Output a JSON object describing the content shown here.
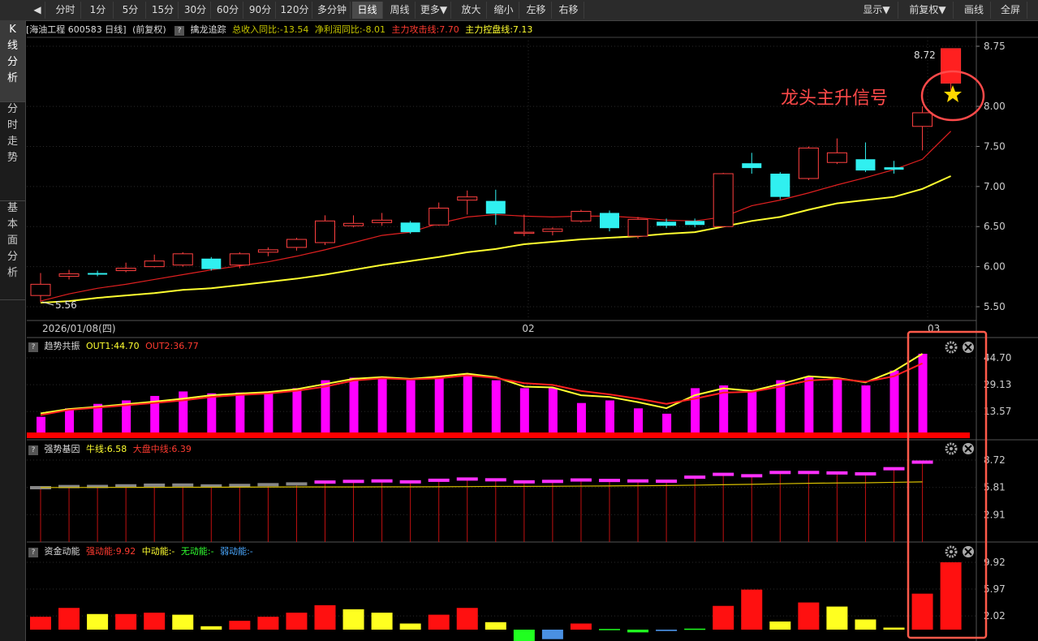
{
  "toolbar": {
    "back_label": "◀",
    "periods": [
      "分时",
      "1分",
      "5分",
      "15分",
      "30分",
      "60分",
      "90分",
      "120分",
      "多分钟",
      "日线",
      "周线",
      "更多▼"
    ],
    "active_period": "日线",
    "actions": [
      "放大",
      "缩小",
      "左移",
      "右移"
    ],
    "right": [
      "显示▼",
      "前复权▼",
      "画线",
      "全屏"
    ]
  },
  "sidebar": {
    "tabs": [
      {
        "label": "K\n线\n分\n析",
        "active": true
      },
      {
        "label": "分\n时\n走\n势",
        "active": false
      },
      {
        "label": "基\n本\n面\n分\n析",
        "active": false
      }
    ]
  },
  "main_header": {
    "title": "[海油工程 600583 日线]",
    "adjust": "(前复权)",
    "help": "?",
    "indicator": "擒龙追踪",
    "rev": "总收入同比:-13.54",
    "profit": "净利润同比:-8.01",
    "attack": "主力攻击线:7.70",
    "control": "主力控盘线:7.13"
  },
  "main_chart": {
    "y_ticks": [
      "8.75",
      "8.00",
      "7.50",
      "7.00",
      "6.50",
      "6.00",
      "5.50"
    ],
    "y_ticks_num": [
      8.75,
      8.0,
      7.5,
      7.0,
      6.5,
      6.0,
      5.5
    ],
    "high_label": "8.72",
    "low_label": "5.56",
    "signal_label": "龙头主升信号",
    "x_labels": [
      "2026/01/08(四)",
      "02",
      "03"
    ],
    "candles": [
      {
        "o": 5.64,
        "c": 5.78,
        "h": 5.92,
        "l": 5.56
      },
      {
        "o": 5.88,
        "c": 5.91,
        "h": 5.96,
        "l": 5.84
      },
      {
        "o": 5.92,
        "c": 5.9,
        "h": 5.95,
        "l": 5.88
      },
      {
        "o": 5.95,
        "c": 5.98,
        "h": 6.05,
        "l": 5.93
      },
      {
        "o": 6.0,
        "c": 6.07,
        "h": 6.15,
        "l": 5.99
      },
      {
        "o": 6.02,
        "c": 6.16,
        "h": 6.18,
        "l": 6.0
      },
      {
        "o": 6.1,
        "c": 5.97,
        "h": 6.12,
        "l": 5.95
      },
      {
        "o": 6.02,
        "c": 6.16,
        "h": 6.18,
        "l": 5.98
      },
      {
        "o": 6.18,
        "c": 6.21,
        "h": 6.24,
        "l": 6.13
      },
      {
        "o": 6.24,
        "c": 6.34,
        "h": 6.36,
        "l": 6.2
      },
      {
        "o": 6.3,
        "c": 6.57,
        "h": 6.64,
        "l": 6.27
      },
      {
        "o": 6.51,
        "c": 6.54,
        "h": 6.64,
        "l": 6.49
      },
      {
        "o": 6.55,
        "c": 6.58,
        "h": 6.67,
        "l": 6.51
      },
      {
        "o": 6.55,
        "c": 6.43,
        "h": 6.57,
        "l": 6.41
      },
      {
        "o": 6.52,
        "c": 6.73,
        "h": 6.8,
        "l": 6.51
      },
      {
        "o": 6.83,
        "c": 6.87,
        "h": 6.95,
        "l": 6.65
      },
      {
        "o": 6.82,
        "c": 6.66,
        "h": 6.96,
        "l": 6.52
      },
      {
        "o": 6.42,
        "c": 6.43,
        "h": 6.65,
        "l": 6.38
      },
      {
        "o": 6.44,
        "c": 6.47,
        "h": 6.49,
        "l": 6.39
      },
      {
        "o": 6.57,
        "c": 6.69,
        "h": 6.71,
        "l": 6.55
      },
      {
        "o": 6.67,
        "c": 6.48,
        "h": 6.7,
        "l": 6.44
      },
      {
        "o": 6.38,
        "c": 6.59,
        "h": 6.62,
        "l": 6.35
      },
      {
        "o": 6.56,
        "c": 6.51,
        "h": 6.6,
        "l": 6.48
      },
      {
        "o": 6.57,
        "c": 6.52,
        "h": 6.6,
        "l": 6.49
      },
      {
        "o": 6.5,
        "c": 7.16,
        "h": 7.17,
        "l": 6.49
      },
      {
        "o": 7.29,
        "c": 7.23,
        "h": 7.42,
        "l": 7.16
      },
      {
        "o": 7.16,
        "c": 6.87,
        "h": 7.18,
        "l": 6.84
      },
      {
        "o": 7.1,
        "c": 7.48,
        "h": 7.5,
        "l": 7.08
      },
      {
        "o": 7.3,
        "c": 7.42,
        "h": 7.6,
        "l": 7.28
      },
      {
        "o": 7.34,
        "c": 7.2,
        "h": 7.55,
        "l": 7.18
      },
      {
        "o": 7.24,
        "c": 7.21,
        "h": 7.32,
        "l": 7.16
      },
      {
        "o": 7.75,
        "c": 7.92,
        "h": 8.0,
        "l": 7.45
      },
      {
        "o": 8.29,
        "c": 8.72,
        "h": 8.72,
        "l": 8.2
      }
    ],
    "ma_red": [
      5.57,
      5.66,
      5.73,
      5.78,
      5.84,
      5.9,
      5.96,
      6.01,
      6.06,
      6.13,
      6.21,
      6.3,
      6.39,
      6.43,
      6.54,
      6.62,
      6.65,
      6.63,
      6.62,
      6.63,
      6.63,
      6.61,
      6.58,
      6.57,
      6.62,
      6.76,
      6.83,
      6.92,
      7.02,
      7.11,
      7.21,
      7.34,
      7.69
    ],
    "ma_yellow": [
      5.55,
      5.57,
      5.61,
      5.64,
      5.67,
      5.71,
      5.73,
      5.77,
      5.81,
      5.85,
      5.9,
      5.96,
      6.02,
      6.07,
      6.12,
      6.18,
      6.22,
      6.28,
      6.31,
      6.34,
      6.36,
      6.38,
      6.41,
      6.43,
      6.5,
      6.57,
      6.62,
      6.71,
      6.79,
      6.83,
      6.87,
      6.97,
      7.13
    ]
  },
  "panel1": {
    "title": "趋势共振",
    "out1": "OUT1:44.70",
    "out2": "OUT2:36.77",
    "y_ticks": [
      "44.70",
      "29.13",
      "13.57"
    ],
    "y_ticks_num": [
      44.7,
      29.13,
      13.57
    ],
    "bars": [
      10.5,
      15.4,
      18.0,
      20.0,
      22.6,
      25.2,
      24.1,
      24.6,
      25.2,
      27.1,
      31.7,
      33.2,
      33.8,
      31.7,
      33.2,
      35.3,
      31.7,
      27.1,
      27.1,
      18.5,
      20.0,
      15.4,
      12.3,
      27.1,
      28.7,
      25.7,
      31.7,
      33.8,
      32.3,
      28.7,
      37.3,
      53.9
    ],
    "line_y": [
      12.5,
      15.0,
      16.3,
      17.8,
      19.3,
      21.0,
      23.0,
      24.0,
      24.8,
      26.5,
      29.5,
      32.5,
      33.5,
      32.5,
      33.8,
      35.5,
      33.5,
      28.0,
      27.5,
      23.0,
      22.0,
      19.0,
      15.5,
      23.0,
      27.0,
      25.5,
      29.5,
      34.0,
      33.0,
      30.5,
      37.0,
      49.0
    ],
    "line_r": [
      11.5,
      14.5,
      15.8,
      17.2,
      18.5,
      20.0,
      22.0,
      23.2,
      24.0,
      25.6,
      28.0,
      31.5,
      32.8,
      32.2,
      32.8,
      34.5,
      33.0,
      30.0,
      29.0,
      25.5,
      23.5,
      21.0,
      18.0,
      21.0,
      24.5,
      25.0,
      28.0,
      31.5,
      32.5,
      30.8,
      34.0,
      41.5
    ]
  },
  "panel2": {
    "title": "强势基因",
    "bull": "牛线:6.58",
    "market": "大盘中线:6.39",
    "y_ticks": [
      "8.72",
      "5.81",
      "2.91"
    ],
    "y_ticks_num": [
      8.72,
      5.81,
      2.91
    ],
    "blocks": [
      {
        "v": 5.78,
        "c": "gray"
      },
      {
        "v": 5.9,
        "c": "gray"
      },
      {
        "v": 5.91,
        "c": "gray"
      },
      {
        "v": 5.98,
        "c": "gray"
      },
      {
        "v": 6.05,
        "c": "gray"
      },
      {
        "v": 6.06,
        "c": "gray"
      },
      {
        "v": 5.97,
        "c": "gray"
      },
      {
        "v": 6.02,
        "c": "gray"
      },
      {
        "v": 6.1,
        "c": "gray"
      },
      {
        "v": 6.18,
        "c": "gray"
      },
      {
        "v": 6.38,
        "c": "mag"
      },
      {
        "v": 6.45,
        "c": "mag"
      },
      {
        "v": 6.5,
        "c": "mag"
      },
      {
        "v": 6.4,
        "c": "mag"
      },
      {
        "v": 6.57,
        "c": "mag"
      },
      {
        "v": 6.7,
        "c": "mag"
      },
      {
        "v": 6.62,
        "c": "mag"
      },
      {
        "v": 6.4,
        "c": "mag"
      },
      {
        "v": 6.45,
        "c": "mag"
      },
      {
        "v": 6.6,
        "c": "mag"
      },
      {
        "v": 6.55,
        "c": "mag"
      },
      {
        "v": 6.5,
        "c": "mag"
      },
      {
        "v": 6.47,
        "c": "mag"
      },
      {
        "v": 6.9,
        "c": "mag"
      },
      {
        "v": 7.2,
        "c": "mag"
      },
      {
        "v": 7.05,
        "c": "mag"
      },
      {
        "v": 7.4,
        "c": "mag"
      },
      {
        "v": 7.4,
        "c": "mag"
      },
      {
        "v": 7.35,
        "c": "mag"
      },
      {
        "v": 7.25,
        "c": "mag"
      },
      {
        "v": 7.8,
        "c": "mag"
      },
      {
        "v": 8.5,
        "c": "mag"
      }
    ],
    "line": [
      5.8,
      5.8,
      5.81,
      5.82,
      5.82,
      5.83,
      5.83,
      5.84,
      5.85,
      5.86,
      5.86,
      5.86,
      5.87,
      5.87,
      5.88,
      5.9,
      5.92,
      5.92,
      5.93,
      5.95,
      5.97,
      5.99,
      6.01,
      6.05,
      6.1,
      6.14,
      6.2,
      6.25,
      6.28,
      6.3,
      6.35,
      6.4
    ]
  },
  "panel3": {
    "title": "资金动能",
    "strong": "强动能:9.92",
    "mid": "中动能:-",
    "none": "无动能:-",
    "weak": "弱动能:-",
    "y_ticks": [
      "9.92",
      "5.97",
      "2.02"
    ],
    "y_ticks_num": [
      9.92,
      5.97,
      2.02
    ],
    "bars": [
      {
        "v": 1.9,
        "c": "red"
      },
      {
        "v": 3.2,
        "c": "red"
      },
      {
        "v": 2.3,
        "c": "yellow"
      },
      {
        "v": 2.3,
        "c": "red"
      },
      {
        "v": 2.5,
        "c": "red"
      },
      {
        "v": 2.2,
        "c": "yellow"
      },
      {
        "v": 0.5,
        "c": "yellow"
      },
      {
        "v": 1.3,
        "c": "red"
      },
      {
        "v": 1.9,
        "c": "red"
      },
      {
        "v": 2.5,
        "c": "red"
      },
      {
        "v": 3.6,
        "c": "red"
      },
      {
        "v": 3.0,
        "c": "yellow"
      },
      {
        "v": 2.5,
        "c": "yellow"
      },
      {
        "v": 0.9,
        "c": "yellow"
      },
      {
        "v": 2.2,
        "c": "red"
      },
      {
        "v": 3.2,
        "c": "red"
      },
      {
        "v": 1.1,
        "c": "yellow"
      },
      {
        "v": -1.7,
        "c": "green"
      },
      {
        "v": -1.4,
        "c": "blue"
      },
      {
        "v": 0.9,
        "c": "red"
      },
      {
        "v": 0.1,
        "c": "green"
      },
      {
        "v": -0.4,
        "c": "green"
      },
      {
        "v": -0.2,
        "c": "blue"
      },
      {
        "v": 0.15,
        "c": "green"
      },
      {
        "v": 3.5,
        "c": "red"
      },
      {
        "v": 5.9,
        "c": "red"
      },
      {
        "v": 1.2,
        "c": "yellow"
      },
      {
        "v": 4.0,
        "c": "red"
      },
      {
        "v": 3.4,
        "c": "yellow"
      },
      {
        "v": 1.5,
        "c": "yellow"
      },
      {
        "v": 0.3,
        "c": "yellow"
      },
      {
        "v": 5.3,
        "c": "red"
      },
      {
        "v": 9.92,
        "c": "red"
      }
    ]
  }
}
